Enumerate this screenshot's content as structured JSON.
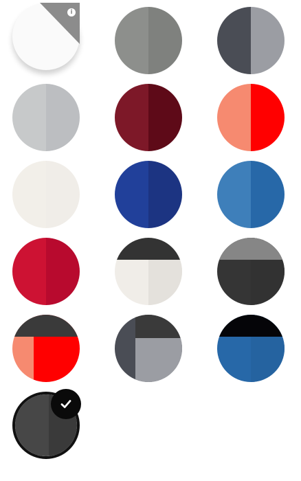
{
  "swatches": [
    {
      "id": "white-custom",
      "row": 0,
      "col": 0,
      "type": "custom",
      "colors": [
        "#fafafa",
        "#8c8c8c"
      ],
      "selected": false
    },
    {
      "id": "grey",
      "row": 0,
      "col": 1,
      "type": "split",
      "colors": [
        "#8d8f8c",
        "#7f817e"
      ],
      "selected": false
    },
    {
      "id": "dark-grey-silver",
      "row": 0,
      "col": 2,
      "type": "split",
      "colors": [
        "#4a4d55",
        "#9b9da3"
      ],
      "selected": false
    },
    {
      "id": "light-grey",
      "row": 1,
      "col": 0,
      "type": "split",
      "colors": [
        "#c7c9ca",
        "#bcbec1"
      ],
      "selected": false
    },
    {
      "id": "burgundy",
      "row": 1,
      "col": 1,
      "type": "split",
      "colors": [
        "#7d1828",
        "#5e0a18"
      ],
      "selected": false
    },
    {
      "id": "salmon-red",
      "row": 1,
      "col": 2,
      "type": "split",
      "colors": [
        "#f68a70",
        "#ff0000"
      ],
      "selected": false
    },
    {
      "id": "off-white",
      "row": 2,
      "col": 0,
      "type": "split",
      "colors": [
        "#f2efe9",
        "#f0ede8"
      ],
      "selected": false
    },
    {
      "id": "royal-blue",
      "row": 2,
      "col": 1,
      "type": "split",
      "colors": [
        "#21409a",
        "#1c3482"
      ],
      "selected": false
    },
    {
      "id": "steel-blue",
      "row": 2,
      "col": 2,
      "type": "split",
      "colors": [
        "#3e7fba",
        "#2768a8"
      ],
      "selected": false
    },
    {
      "id": "crimson",
      "row": 3,
      "col": 0,
      "type": "split",
      "colors": [
        "#cd1233",
        "#b80a2e"
      ],
      "selected": false
    },
    {
      "id": "dark-over-off-white",
      "row": 3,
      "col": 1,
      "type": "topband",
      "colors": [
        "#333333",
        "#f0ede8"
      ],
      "selected": false
    },
    {
      "id": "grey-over-charcoal",
      "row": 3,
      "col": 2,
      "type": "topband",
      "colors": [
        "#868686",
        "#353535"
      ],
      "selected": false
    },
    {
      "id": "dark-over-salmon-red",
      "row": 4,
      "col": 0,
      "type": "topband-split",
      "colors": [
        "#3a3a3a",
        "#f68a70",
        "#ff0000"
      ],
      "selected": false
    },
    {
      "id": "dark-over-silver",
      "row": 4,
      "col": 1,
      "type": "corner",
      "colors": [
        "#3a3a3a",
        "#4a4d55",
        "#9b9da3"
      ],
      "selected": false
    },
    {
      "id": "black-over-steel-blue",
      "row": 4,
      "col": 2,
      "type": "topband",
      "colors": [
        "#050508",
        "#2768a8"
      ],
      "selected": false
    },
    {
      "id": "charcoal",
      "row": 5,
      "col": 0,
      "type": "split",
      "colors": [
        "#474747",
        "#3a3a3a"
      ],
      "selected": true
    }
  ],
  "icons": {
    "info": "info-icon",
    "check": "checkmark-icon"
  },
  "info_glyph": "i"
}
